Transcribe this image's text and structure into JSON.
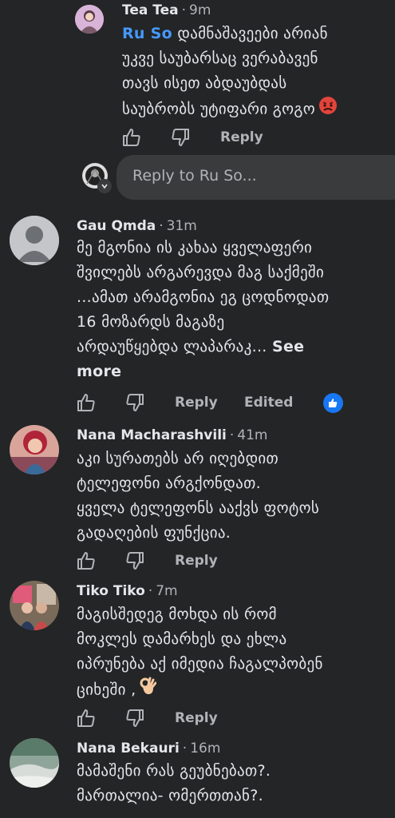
{
  "comments": [
    {
      "author": "Tea Tea",
      "time": "9m",
      "mention": "Ru So",
      "lines": [
        " დამნაშავეები არიან",
        "უკვე საუბარსაც ვერაბავენ",
        "თავს ისეთ აბდაუბდას",
        "საუბრობს უტიფარი გოგო"
      ],
      "emoji_icon": "angry-face-icon",
      "actions": {
        "reply": "Reply"
      }
    },
    {
      "author": "Gau Qmda",
      "time": "31m",
      "lines": [
        "მე მგონია ის კახაა ყველაფერი",
        "შვილებს არგარევდა მაგ საქმეში",
        "...ამათ არამგონია ეგ ცოდნოდათ",
        "16 მოზარდს მაგაზე",
        "არდაუწყებდა ლაპარაკ... "
      ],
      "see_more": "See",
      "see_more_2": "more",
      "actions": {
        "reply": "Reply",
        "edited": "Edited"
      },
      "reaction_icon": "like-reaction-icon"
    },
    {
      "author": "Nana Macharashvili",
      "time": "41m",
      "lines": [
        "აკი სურათებს არ იღებდით",
        "ტელეფონი არგქონდათ.",
        "ყველა ტელეფონს ააქვს ფოტოს",
        "გადაღების ფუნქცია."
      ],
      "actions": {
        "reply": "Reply"
      }
    },
    {
      "author": "Tiko Tiko",
      "time": "7m",
      "lines": [
        "მაგისშედეგ მოხდა ის რომ",
        "მოკლეს დამარხეს და ეხლა",
        "იპრუნება აქ იმედია ჩაგალპობენ",
        "ციხეში ,"
      ],
      "emoji_icon": "ok-hand-icon",
      "actions": {
        "reply": "Reply"
      }
    },
    {
      "author": "Nana Bekauri",
      "time": "16m",
      "lines": [
        "მამაშენი რას გეუბნებათ?.",
        "მართალია- ომერთთან?."
      ]
    }
  ],
  "reply_box": {
    "placeholder": "Reply to Ru So..."
  },
  "colors": {
    "background": "#242526",
    "text": "#e4e6eb",
    "secondary": "#b0b3b8",
    "mention": "#4599ff",
    "like_blue": "#1877f2",
    "input_bg": "#3a3b3c"
  }
}
